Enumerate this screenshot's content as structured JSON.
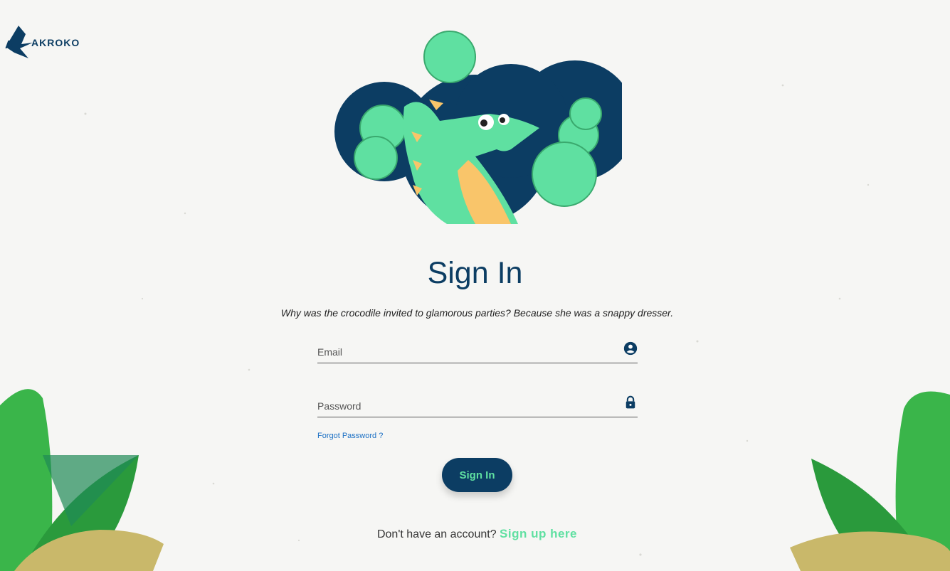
{
  "brand": {
    "logo_text": "AKROKO"
  },
  "form": {
    "title": "Sign In",
    "joke": "Why was the crocodile invited to glamorous parties? Because she was a snappy dresser.",
    "email_placeholder": "Email",
    "password_placeholder": "Password",
    "forgot_label": "Forgot Password ?",
    "submit_label": "Sign In"
  },
  "signup": {
    "prompt": "Don't have an account?",
    "link_label": "Sign up here"
  },
  "icons": {
    "email_field": "account-circle-icon",
    "password_field": "lock-icon"
  },
  "colors": {
    "primary": "#0c3d63",
    "accent": "#5fe0a1",
    "link": "#1a6fc4",
    "background": "#f6f6f4"
  }
}
